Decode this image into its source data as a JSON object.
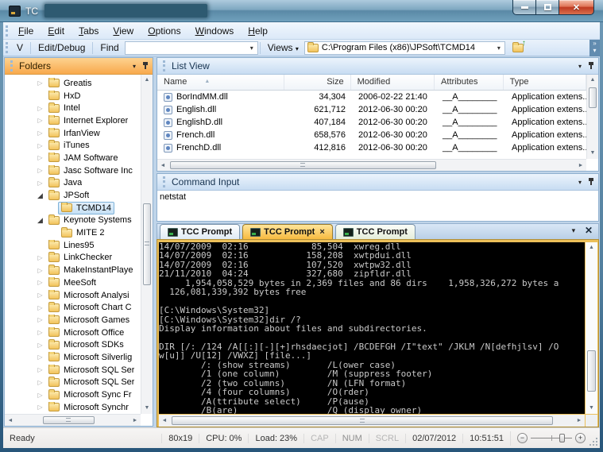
{
  "window": {
    "title": "TC"
  },
  "menu": {
    "items": [
      "File",
      "Edit",
      "Tabs",
      "View",
      "Options",
      "Windows",
      "Help"
    ]
  },
  "toolbar": {
    "v_label": "V",
    "edit_debug_label": "Edit/Debug",
    "find_label": "Find",
    "find_value": "",
    "views_label": "Views",
    "path_value": "C:\\Program Files (x86)\\JPSoft\\TCMD14"
  },
  "folders_panel": {
    "title": "Folders",
    "items": [
      {
        "label": "Greatis",
        "state": "collapsed",
        "level": 1
      },
      {
        "label": "HxD",
        "state": "none",
        "level": 1
      },
      {
        "label": "Intel",
        "state": "collapsed",
        "level": 1
      },
      {
        "label": "Internet Explorer",
        "state": "collapsed",
        "level": 1
      },
      {
        "label": "IrfanView",
        "state": "collapsed",
        "level": 1
      },
      {
        "label": "iTunes",
        "state": "collapsed",
        "level": 1
      },
      {
        "label": "JAM Software",
        "state": "collapsed",
        "level": 1
      },
      {
        "label": "Jasc Software Inc",
        "state": "collapsed",
        "level": 1
      },
      {
        "label": "Java",
        "state": "collapsed",
        "level": 1
      },
      {
        "label": "JPSoft",
        "state": "expanded",
        "level": 1
      },
      {
        "label": "TCMD14",
        "state": "none",
        "level": 2,
        "selected": true
      },
      {
        "label": "Keynote Systems",
        "state": "expanded",
        "level": 1
      },
      {
        "label": "MITE 2",
        "state": "none",
        "level": 2
      },
      {
        "label": "Lines95",
        "state": "none",
        "level": 1
      },
      {
        "label": "LinkChecker",
        "state": "collapsed",
        "level": 1
      },
      {
        "label": "MakeInstantPlaye",
        "state": "collapsed",
        "level": 1
      },
      {
        "label": "MeeSoft",
        "state": "collapsed",
        "level": 1
      },
      {
        "label": "Microsoft Analysi",
        "state": "collapsed",
        "level": 1
      },
      {
        "label": "Microsoft Chart C",
        "state": "collapsed",
        "level": 1
      },
      {
        "label": "Microsoft Games",
        "state": "collapsed",
        "level": 1
      },
      {
        "label": "Microsoft Office",
        "state": "collapsed",
        "level": 1
      },
      {
        "label": "Microsoft SDKs",
        "state": "collapsed",
        "level": 1
      },
      {
        "label": "Microsoft Silverlig",
        "state": "collapsed",
        "level": 1
      },
      {
        "label": "Microsoft SQL Ser",
        "state": "collapsed",
        "level": 1
      },
      {
        "label": "Microsoft SQL Ser",
        "state": "collapsed",
        "level": 1
      },
      {
        "label": "Microsoft Sync Fr",
        "state": "collapsed",
        "level": 1
      },
      {
        "label": "Microsoft Synchr",
        "state": "collapsed",
        "level": 1
      }
    ]
  },
  "list_view": {
    "title": "List View",
    "columns": [
      "Name",
      "Size",
      "Modified",
      "Attributes",
      "Type"
    ],
    "rows": [
      {
        "name": "BorIndMM.dll",
        "size": "34,304",
        "modified": "2006-02-22 21:40",
        "attributes": "__A________",
        "type": "Application extens..."
      },
      {
        "name": "English.dll",
        "size": "621,712",
        "modified": "2012-06-30 00:20",
        "attributes": "__A________",
        "type": "Application extens..."
      },
      {
        "name": "EnglishD.dll",
        "size": "407,184",
        "modified": "2012-06-30 00:20",
        "attributes": "__A________",
        "type": "Application extens..."
      },
      {
        "name": "French.dll",
        "size": "658,576",
        "modified": "2012-06-30 00:20",
        "attributes": "__A________",
        "type": "Application extens..."
      },
      {
        "name": "FrenchD.dll",
        "size": "412,816",
        "modified": "2012-06-30 00:20",
        "attributes": "__A________",
        "type": "Application extens..."
      }
    ]
  },
  "command_input": {
    "title": "Command Input",
    "value": "netstat"
  },
  "tab_bar": {
    "tabs": [
      {
        "label": "TCC Prompt",
        "active": false
      },
      {
        "label": "TCC Prompt",
        "active": true
      },
      {
        "label": "TCC Prompt",
        "active": false
      }
    ]
  },
  "console": {
    "lines": [
      "14/07/2009  02:16            85,504  xwreg.dll",
      "14/07/2009  02:16           158,208  xwtpdui.dll",
      "14/07/2009  02:16           107,520  xwtpw32.dll",
      "21/11/2010  04:24           327,680  zipfldr.dll",
      "     1,954,058,529 bytes in 2,369 files and 86 dirs    1,958,326,272 bytes a",
      "  126,081,339,392 bytes free",
      "",
      "[C:\\Windows\\System32]",
      "[C:\\Windows\\System32]dir /?",
      "Display information about files and subdirectories.",
      "",
      "DIR [/: /124 /A[[:][-][+]rhsdaecjot] /BCDEFGH /I\"text\" /JKLM /N[defhjlsv] /O",
      "w[u]] /U[12] /VWXZ] [file...]",
      "        /: (show streams)       /L(ower case)",
      "        /1 (one column)         /M (suppress footer)",
      "        /2 (two columns)        /N (LFN format)",
      "        /4 (four columns)       /O(rder)",
      "        /A(ttribute select)     /P(ause)",
      "        /B(are)                 /Q (display owner)"
    ]
  },
  "status_bar": {
    "ready": "Ready",
    "console_size": "80x19",
    "cpu": "CPU: 0%",
    "load": "Load: 23%",
    "caps": "CAP",
    "num": "NUM",
    "scroll": "SCRL",
    "date": "02/07/2012",
    "time": "10:51:51",
    "zoom_minus": "−",
    "zoom_plus": "+"
  },
  "colors": {
    "active_tab_gold": "#f7ba40",
    "folders_header_orange": "#f8a94c",
    "panel_header_blue": "#c7dcf2",
    "console_frame_gold": "#ecc05a",
    "console_bg": "#000000",
    "console_text": "#c9c9c9",
    "titlebar_teal": "#5a89a6",
    "close_button_red": "#bf3a20"
  },
  "icons": {
    "dropdown_glyph": "▾",
    "close_glyph": "✕",
    "tab_close_glyph": "×",
    "sort_asc_glyph": "▲",
    "tree_collapsed_glyph": "▷",
    "tree_expanded_glyph": "◢",
    "scroll_up_glyph": "▲",
    "scroll_down_glyph": "▼",
    "scroll_left_glyph": "◄",
    "scroll_right_glyph": "►",
    "overflow_glyph": "»",
    "up_arrow_glyph": "↑"
  }
}
